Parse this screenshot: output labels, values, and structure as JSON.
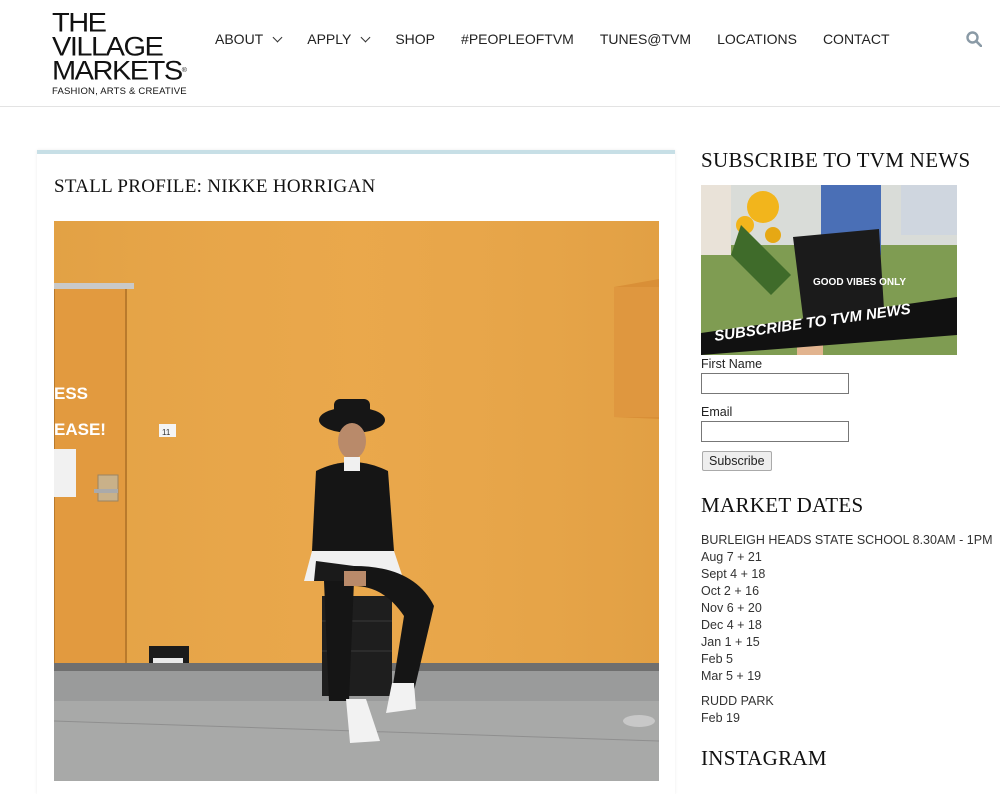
{
  "logo": {
    "line1": "THE",
    "line2": "VILLAGE",
    "line3": "MARKETS",
    "tm": "®",
    "tagline": "FASHION, ARTS & CREATIVE"
  },
  "nav": {
    "about": "ABOUT",
    "apply": "APPLY",
    "shop": "SHOP",
    "people": "#PEOPLEOFTVM",
    "tunes": "TUNES@TVM",
    "locations": "LOCATIONS",
    "contact": "CONTACT"
  },
  "post": {
    "title": "STALL PROFILE: NIKKE HORRIGAN",
    "photo_text": {
      "line1": "ESS",
      "line2": "EASE!",
      "sign": "11"
    }
  },
  "sidebar": {
    "subscribe_heading": "SUBSCRIBE TO TVM NEWS",
    "banner_text": "SUBSCRIBE TO TVM NEWS",
    "bag_text": "GOOD VIBES ONLY",
    "first_name_label": "First Name",
    "email_label": "Email",
    "subscribe_button": "Subscribe",
    "market_dates_heading": "MARKET DATES",
    "venue1": "BURLEIGH HEADS STATE SCHOOL 8.30AM - 1PM",
    "dates1": [
      "Aug 7 + 21",
      "Sept 4 + 18",
      "Oct 2 + 16",
      "Nov 6 + 20",
      "Dec 4 + 18",
      "Jan 1 + 15",
      "Feb 5",
      "Mar 5 + 19"
    ],
    "venue2": "RUDD PARK",
    "dates2": [
      "Feb 19"
    ],
    "instagram_heading": "INSTAGRAM"
  },
  "colors": {
    "card_top": "#c7dfe6",
    "wall": "#e8a649",
    "accent_text": "#111111"
  }
}
